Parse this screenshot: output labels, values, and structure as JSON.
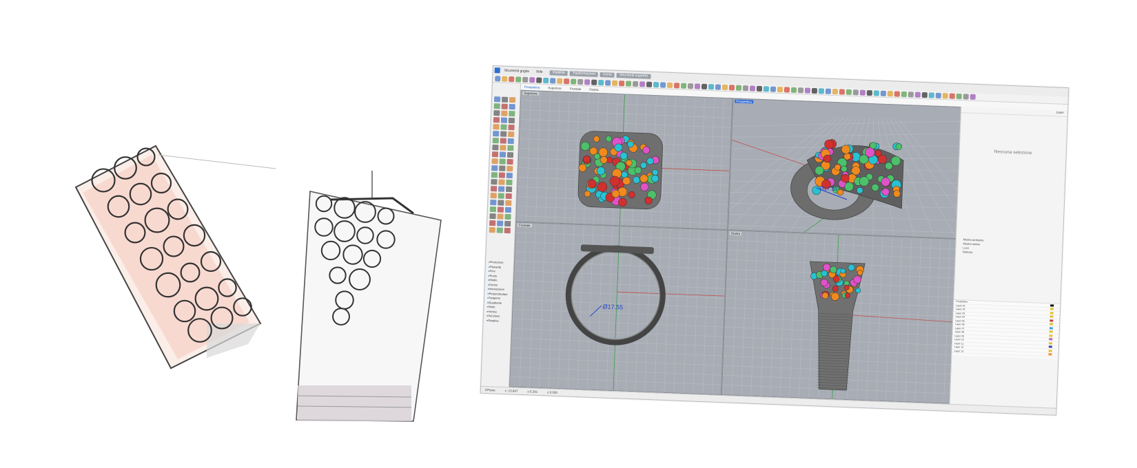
{
  "app": {
    "title": "Rhinoceros",
    "menu": [
      "Strumenti griglia",
      "Stile"
    ],
    "menu_tabs": [
      "Visibilità",
      "Trasformazioni",
      "Curve",
      "Strumenti superfici"
    ]
  },
  "tabs": {
    "items": [
      "Prospettiva",
      "Superiore",
      "Frontale",
      "Destra"
    ],
    "active": "Prospettiva"
  },
  "viewports": {
    "top_label": "Superiore",
    "perspective_label": "Prospettiva",
    "front_label": "Frontale",
    "right_label": "Destra"
  },
  "dimension": {
    "front_value": "Ø17.55",
    "perspective_value": "Ø17.55"
  },
  "right_panel": {
    "header": "Layer",
    "no_selection": "Nessuna selezione",
    "options": [
      "Mostra ambiente",
      "Mostra ombre",
      "Luce",
      "Reticolo"
    ],
    "layers": [
      "Predefinito",
      "Layer 01",
      "Layer 02",
      "Layer 03",
      "Layer 04",
      "Layer 05",
      "Layer 06",
      "Layer 07",
      "Layer 08",
      "Layer 09",
      "Layer 10",
      "Layer 11",
      "Layer 12",
      "Layer 13"
    ]
  },
  "left_panel": {
    "items": [
      "Proiezione",
      "Planarità",
      "Fine",
      "Punto",
      "Medio",
      "Centro",
      "Intersezione",
      "Perpendicolare",
      "Tangente",
      "Quadrante",
      "Nodo",
      "Vertice",
      "Sul piano",
      "Disattiva"
    ]
  },
  "status": {
    "cplane": "CPlane",
    "x": "x -13.847",
    "y": "y 5.291",
    "z": "z 0.000"
  },
  "colors": {
    "viewport_bg": "#a8adb5",
    "axis_red": "#c0504d",
    "axis_green": "#3aa04a",
    "active_label": "#2f6bd6",
    "gem_orange": "#f08a1e",
    "gem_cyan": "#27c3d4",
    "gem_magenta": "#e052c8",
    "gem_green": "#4cc06a",
    "gem_red": "#d2302f",
    "sketch_pink": "#f3b4a0"
  }
}
